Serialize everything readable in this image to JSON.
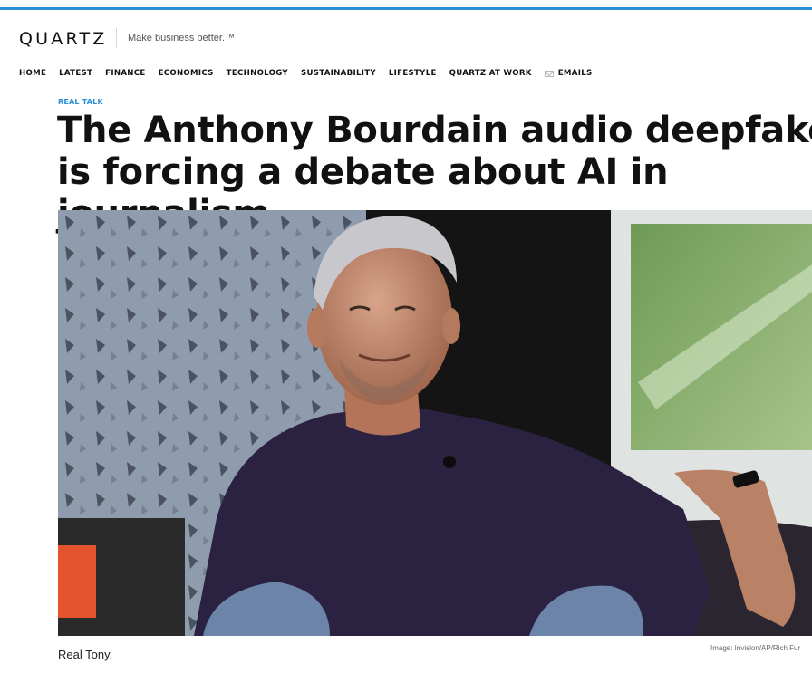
{
  "site": {
    "logo": "QUARTZ",
    "tagline": "Make business better.™",
    "accent_color": "#2a8fd6"
  },
  "nav": {
    "items": [
      {
        "label": "HOME"
      },
      {
        "label": "LATEST"
      },
      {
        "label": "FINANCE"
      },
      {
        "label": "ECONOMICS"
      },
      {
        "label": "TECHNOLOGY"
      },
      {
        "label": "SUSTAINABILITY"
      },
      {
        "label": "LIFESTYLE"
      },
      {
        "label": "QUARTZ AT WORK"
      }
    ],
    "emails": {
      "label": "EMAILS",
      "icon": "envelope-icon"
    }
  },
  "article": {
    "kicker": "REAL TALK",
    "headline": "The Anthony Bourdain audio deepfake is forcing a debate about AI in journalism",
    "image": {
      "caption": "Real Tony.",
      "credit": "Image: Invision/AP/Rich Fur"
    }
  }
}
